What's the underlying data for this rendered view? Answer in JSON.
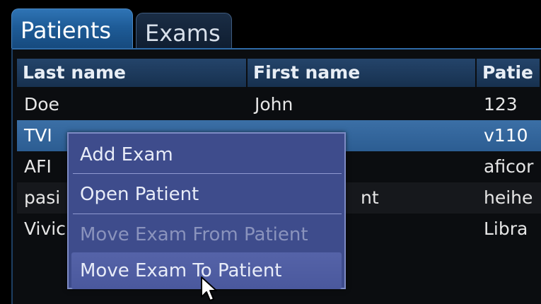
{
  "tabs": [
    {
      "label": "Patients",
      "active": true
    },
    {
      "label": "Exams",
      "active": false
    }
  ],
  "table": {
    "columns": [
      "Last name",
      "First name",
      "Patie"
    ],
    "rows": [
      {
        "last": "Doe",
        "first": "John",
        "id": "123"
      },
      {
        "last": "TVI",
        "first": "",
        "id": "v110"
      },
      {
        "last": "AFI",
        "first": "",
        "id": "aficor"
      },
      {
        "last": "pasi",
        "first": "nt",
        "id": "heihe"
      },
      {
        "last": "Vivic",
        "first": "",
        "id": "Libra"
      }
    ],
    "selected_row": "TVI"
  },
  "context_menu": {
    "items": [
      {
        "label": "Add Exam",
        "state": "enabled"
      },
      {
        "label": "Open Patient",
        "state": "enabled"
      },
      {
        "label": "Move Exam From Patient",
        "state": "disabled"
      },
      {
        "label": "Move Exam To Patient",
        "state": "hovered"
      }
    ]
  },
  "colors": {
    "accent": "#2f74b5",
    "selected_row": "#3b6fa6",
    "menu_background": "#3e4c8c",
    "menu_border": "#7e8bc4"
  },
  "icons": {
    "cursor": "arrow-pointer-icon"
  }
}
